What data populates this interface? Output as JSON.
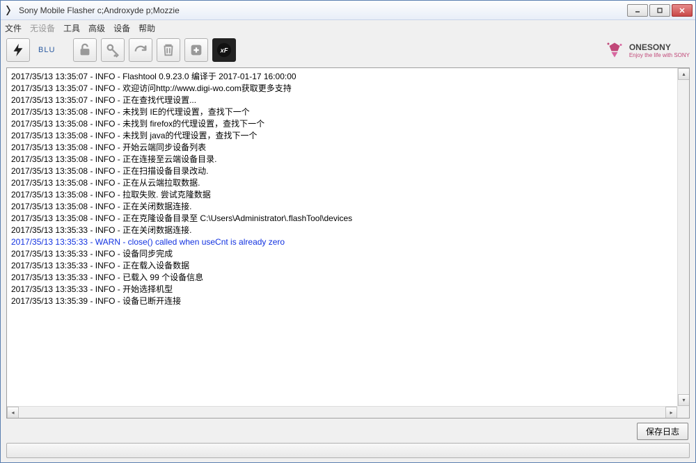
{
  "window": {
    "title": "Sony Mobile Flasher c;Androxyde p;Mozzie"
  },
  "menu": {
    "items": [
      "文件",
      "无设备",
      "工具",
      "高级",
      "设备",
      "帮助"
    ],
    "disabled_index": 1
  },
  "toolbar": {
    "blu_label": "BLU"
  },
  "brand": {
    "name": "ONESONY",
    "tagline": "Enjoy the life with SONY"
  },
  "log": {
    "lines": [
      {
        "t": "2017/35/13 13:35:07",
        "lvl": "INFO",
        "msg": "Flashtool  0.9.23.0 编译于 2017-01-17 16:00:00"
      },
      {
        "t": "2017/35/13 13:35:07",
        "lvl": "INFO",
        "msg": "欢迎访问http://www.digi-wo.com获取更多支持"
      },
      {
        "t": "2017/35/13 13:35:07",
        "lvl": "INFO",
        "msg": "正在查找代理设置..."
      },
      {
        "t": "2017/35/13 13:35:08",
        "lvl": "INFO",
        "msg": "未找到 IE的代理设置，查找下一个"
      },
      {
        "t": "2017/35/13 13:35:08",
        "lvl": "INFO",
        "msg": "未找到 firefox的代理设置，查找下一个"
      },
      {
        "t": "2017/35/13 13:35:08",
        "lvl": "INFO",
        "msg": "未找到 java的代理设置，查找下一个"
      },
      {
        "t": "2017/35/13 13:35:08",
        "lvl": "INFO",
        "msg": "开始云端同步设备列表"
      },
      {
        "t": "2017/35/13 13:35:08",
        "lvl": "INFO",
        "msg": "正在连接至云端设备目录."
      },
      {
        "t": "2017/35/13 13:35:08",
        "lvl": "INFO",
        "msg": "正在扫描设备目录改动."
      },
      {
        "t": "2017/35/13 13:35:08",
        "lvl": "INFO",
        "msg": "正在从云端拉取数据."
      },
      {
        "t": "2017/35/13 13:35:08",
        "lvl": "INFO",
        "msg": "拉取失败. 尝试克隆数据"
      },
      {
        "t": "2017/35/13 13:35:08",
        "lvl": "INFO",
        "msg": "正在关闭数据连接."
      },
      {
        "t": "2017/35/13 13:35:08",
        "lvl": "INFO",
        "msg": "正在克隆设备目录至  C:\\Users\\Administrator\\.flashTool\\devices"
      },
      {
        "t": "2017/35/13 13:35:33",
        "lvl": "INFO",
        "msg": "正在关闭数据连接."
      },
      {
        "t": "2017/35/13 13:35:33",
        "lvl": "WARN",
        "msg": "close() called when useCnt is already zero",
        "warn": true
      },
      {
        "t": "2017/35/13 13:35:33",
        "lvl": "INFO",
        "msg": "设备同步完成"
      },
      {
        "t": "2017/35/13 13:35:33",
        "lvl": "INFO",
        "msg": "正在载入设备数据"
      },
      {
        "t": "2017/35/13 13:35:33",
        "lvl": "INFO",
        "msg": "已载入  99 个设备信息"
      },
      {
        "t": "2017/35/13 13:35:33",
        "lvl": "INFO",
        "msg": "开始选择机型"
      },
      {
        "t": "2017/35/13 13:35:39",
        "lvl": "INFO",
        "msg": "设备已断开连接"
      }
    ]
  },
  "footer": {
    "save_log": "保存日志"
  }
}
